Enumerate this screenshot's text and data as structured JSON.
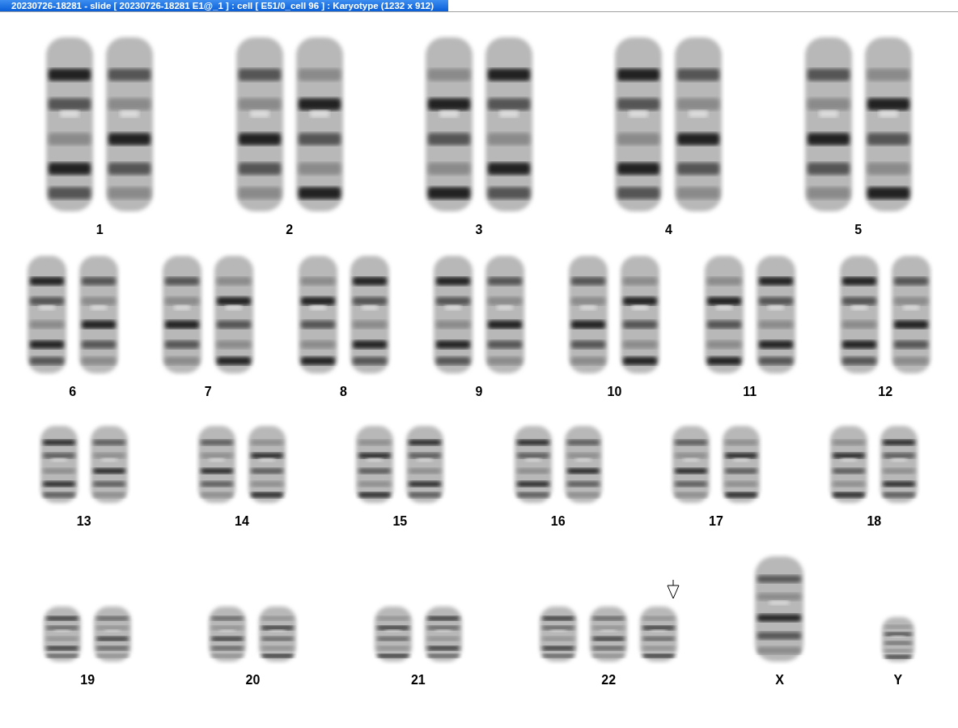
{
  "window": {
    "title": "20230726-18281 - slide [ 20230726-18281 E1@_1 ] : cell [ E51/0_cell 96 ] : Karyotype  (1232 x 912)"
  },
  "karyotype": {
    "rows": [
      {
        "groups": [
          {
            "label": "1",
            "kind": "pair",
            "marked": false
          },
          {
            "label": "2",
            "kind": "pair",
            "marked": false
          },
          {
            "label": "3",
            "kind": "pair",
            "marked": false
          },
          {
            "label": "4",
            "kind": "pair",
            "marked": false
          },
          {
            "label": "5",
            "kind": "pair",
            "marked": false
          }
        ]
      },
      {
        "groups": [
          {
            "label": "6",
            "kind": "pair",
            "marked": false
          },
          {
            "label": "7",
            "kind": "pair",
            "marked": false
          },
          {
            "label": "8",
            "kind": "pair",
            "marked": false
          },
          {
            "label": "9",
            "kind": "pair",
            "marked": false
          },
          {
            "label": "10",
            "kind": "pair",
            "marked": false
          },
          {
            "label": "11",
            "kind": "pair",
            "marked": false
          },
          {
            "label": "12",
            "kind": "pair",
            "marked": false
          }
        ]
      },
      {
        "groups": [
          {
            "label": "13",
            "kind": "pair",
            "marked": false
          },
          {
            "label": "14",
            "kind": "pair",
            "marked": false
          },
          {
            "label": "15",
            "kind": "pair",
            "marked": false
          },
          {
            "label": "16",
            "kind": "pair",
            "marked": false
          },
          {
            "label": "17",
            "kind": "pair",
            "marked": false
          },
          {
            "label": "18",
            "kind": "pair",
            "marked": false
          }
        ]
      },
      {
        "groups": [
          {
            "label": "19",
            "kind": "pair",
            "marked": false
          },
          {
            "label": "20",
            "kind": "pair",
            "marked": false
          },
          {
            "label": "21",
            "kind": "pair",
            "marked": false
          },
          {
            "label": "22",
            "kind": "triple",
            "marked": true
          },
          {
            "label": "X",
            "kind": "single-large",
            "marked": false
          },
          {
            "label": "Y",
            "kind": "single-small",
            "marked": false
          }
        ]
      }
    ]
  }
}
